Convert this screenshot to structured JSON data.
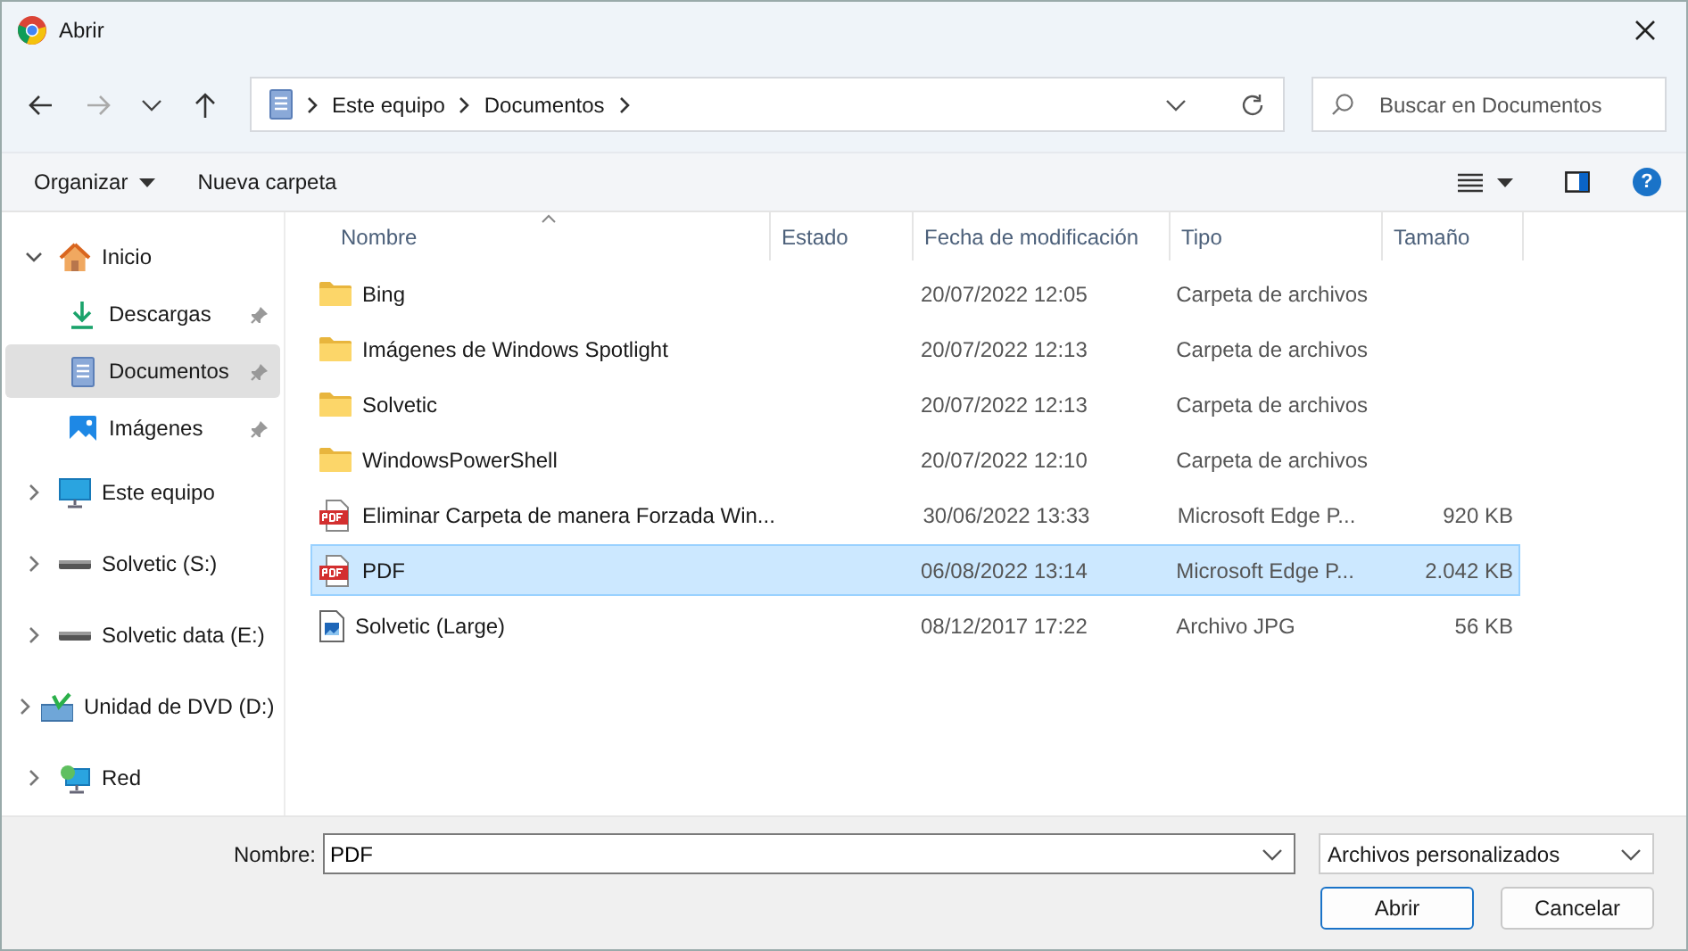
{
  "window": {
    "title": "Abrir"
  },
  "address": {
    "segments": [
      "Este equipo",
      "Documentos"
    ]
  },
  "search": {
    "placeholder": "Buscar en Documentos"
  },
  "toolbar": {
    "organize": "Organizar",
    "new_folder": "Nueva carpeta",
    "help": "?"
  },
  "sidebar": {
    "items": [
      {
        "label": "Inicio",
        "kind": "home",
        "expanded": true,
        "selected": false,
        "children": [
          {
            "label": "Descargas",
            "kind": "download",
            "selected": false
          },
          {
            "label": "Documentos",
            "kind": "document",
            "selected": true
          },
          {
            "label": "Imágenes",
            "kind": "pictures",
            "selected": false
          }
        ]
      },
      {
        "label": "Este equipo",
        "kind": "computer",
        "expanded": false,
        "selected": false
      },
      {
        "label": "Solvetic (S:)",
        "kind": "drive",
        "expanded": false,
        "selected": false
      },
      {
        "label": "Solvetic data (E:)",
        "kind": "drive",
        "expanded": false,
        "selected": false
      },
      {
        "label": "Unidad de DVD (D:)",
        "kind": "dvd",
        "expanded": false,
        "selected": false
      },
      {
        "label": "Red",
        "kind": "network",
        "expanded": false,
        "selected": false
      }
    ]
  },
  "table": {
    "columns": [
      "Nombre",
      "Estado",
      "Fecha de modificación",
      "Tipo",
      "Tamaño"
    ],
    "rows": [
      {
        "kind": "folder",
        "name": "Bing",
        "date": "20/07/2022 12:05",
        "type": "Carpeta de archivos",
        "selected": false
      },
      {
        "kind": "folder",
        "name": "Imágenes de Windows Spotlight",
        "date": "20/07/2022 12:13",
        "type": "Carpeta de archivos",
        "selected": false
      },
      {
        "kind": "folder",
        "name": "Solvetic",
        "date": "20/07/2022 12:13",
        "type": "Carpeta de archivos",
        "selected": false
      },
      {
        "kind": "folder",
        "name": "WindowsPowerShell",
        "date": "20/07/2022 12:10",
        "type": "Carpeta de archivos",
        "selected": false
      },
      {
        "kind": "pdf",
        "name": "Eliminar Carpeta de manera Forzada Win...",
        "date": "30/06/2022 13:33",
        "type": "Microsoft Edge P...",
        "size": "920 KB",
        "selected": false
      },
      {
        "kind": "pdf",
        "name": "PDF",
        "date": "06/08/2022 13:14",
        "type": "Microsoft Edge P...",
        "size": "2.042 KB",
        "selected": true
      },
      {
        "kind": "image",
        "name": "Solvetic (Large)",
        "date": "08/12/2017 17:22",
        "type": "Archivo JPG",
        "size": "56 KB",
        "selected": false
      }
    ]
  },
  "footer": {
    "name_label": "Nombre:",
    "name_value": "PDF",
    "filter": "Archivos personalizados",
    "buttons": [
      "Abrir",
      "Cancelar"
    ]
  }
}
